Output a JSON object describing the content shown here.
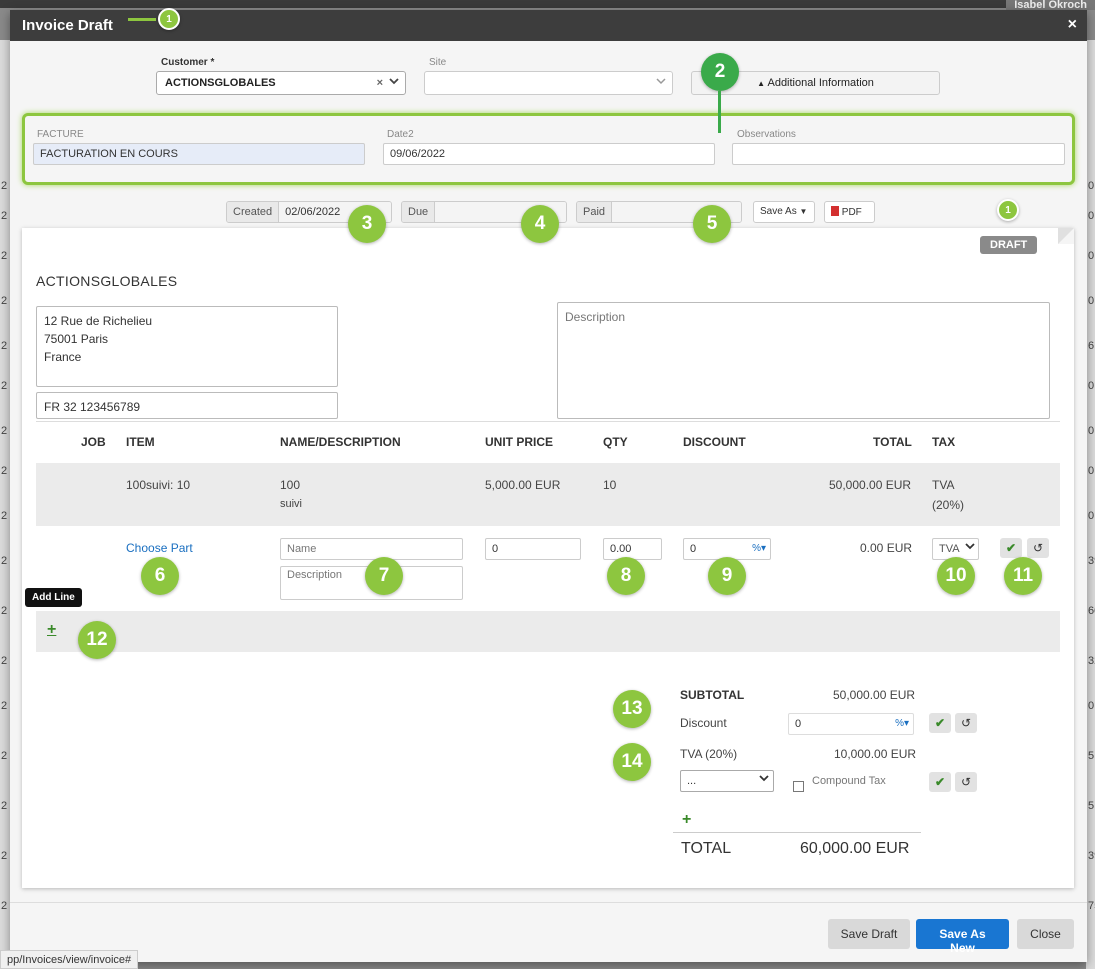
{
  "modal": {
    "title": "Invoice Draft",
    "close": "×"
  },
  "background": {
    "user": "Isabel Okroch",
    "row_digits": [
      "2",
      "2",
      "2",
      "2",
      "2",
      "2",
      "2",
      "2",
      "2",
      "2",
      "2",
      "2",
      "2",
      "2",
      "2",
      "2",
      "2"
    ],
    "right_digits": [
      "0",
      "0",
      "0",
      "0",
      "6",
      "0",
      "0",
      "0",
      "0",
      "39",
      "60",
      "32",
      "0",
      "5",
      "5",
      "39",
      "75"
    ]
  },
  "customer": {
    "label": "Customer *",
    "value": "ACTIONSGLOBALES",
    "clear": "×"
  },
  "site": {
    "label": "Site",
    "value": ""
  },
  "additional_info": {
    "label": "Additional Information"
  },
  "facture": {
    "label": "FACTURE",
    "value": "FACTURATION EN COURS"
  },
  "date2": {
    "label": "Date2",
    "value": "09/06/2022"
  },
  "observations": {
    "label": "Observations",
    "value": ""
  },
  "dates": {
    "created_label": "Created",
    "created_value": "02/06/2022",
    "due_label": "Due",
    "due_value": "",
    "paid_label": "Paid",
    "paid_value": ""
  },
  "save_as": "Save As",
  "pdf": "PDF",
  "status": "DRAFT",
  "invoice": {
    "customer_name": "ACTIONSGLOBALES",
    "address": [
      "12 Rue de Richelieu",
      "75001 Paris",
      "France"
    ],
    "vat_number": "FR 32 123456789",
    "description_placeholder": "Description"
  },
  "table": {
    "headers": {
      "job": "JOB",
      "item": "ITEM",
      "name": "NAME/DESCRIPTION",
      "unit_price": "UNIT PRICE",
      "qty": "QTY",
      "discount": "DISCOUNT",
      "total": "TOTAL",
      "tax": "TAX"
    },
    "line": {
      "item": "100suivi: 10",
      "name": "100",
      "description": "suivi",
      "unit_price": "5,000.00 EUR",
      "qty": "10",
      "total": "50,000.00 EUR",
      "tax": "TVA",
      "tax_rate": "(20%)"
    },
    "new_line": {
      "choose_part": "Choose Part",
      "name_placeholder": "Name",
      "description_placeholder": "Description",
      "unit_price": "0",
      "qty": "0.00",
      "discount": "0",
      "discount_unit": "%",
      "total": "0.00 EUR",
      "tax": "TVA"
    },
    "add_line_tooltip": "Add Line",
    "add_line_icon": "+"
  },
  "summary": {
    "subtotal_label": "SUBTOTAL",
    "subtotal_value": "50,000.00 EUR",
    "discount_label": "Discount",
    "discount_value": "0",
    "discount_unit": "%",
    "tax_label": "TVA (20%)",
    "tax_value": "10,000.00 EUR",
    "tax_select": "...",
    "compound_tax": "Compound Tax",
    "add_icon": "+",
    "total_label": "TOTAL",
    "total_value": "60,000.00 EUR"
  },
  "footer": {
    "save_draft": "Save Draft",
    "save_as_new": "Save As New",
    "close": "Close"
  },
  "statusbar": "pp/Invoices/view/invoice#",
  "markers": [
    "1",
    "2",
    "3",
    "4",
    "5",
    "6",
    "7",
    "8",
    "9",
    "10",
    "11",
    "12",
    "13",
    "14",
    "1"
  ],
  "colors": {
    "accent_green": "#8dc63f",
    "primary_blue": "#1976d2",
    "header_dark": "#3d3d3d",
    "link_blue": "#1a6fc0"
  }
}
